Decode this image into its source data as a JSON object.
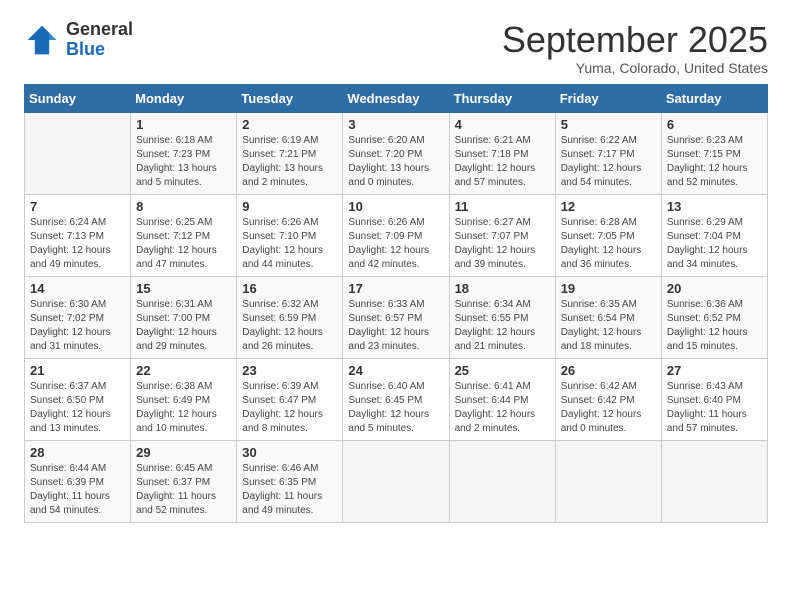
{
  "header": {
    "logo_line1": "General",
    "logo_line2": "Blue",
    "month_title": "September 2025",
    "location": "Yuma, Colorado, United States"
  },
  "calendar": {
    "days_of_week": [
      "Sunday",
      "Monday",
      "Tuesday",
      "Wednesday",
      "Thursday",
      "Friday",
      "Saturday"
    ],
    "weeks": [
      [
        {
          "day": "",
          "sunrise": "",
          "sunset": "",
          "daylight": ""
        },
        {
          "day": "1",
          "sunrise": "Sunrise: 6:18 AM",
          "sunset": "Sunset: 7:23 PM",
          "daylight": "Daylight: 13 hours and 5 minutes."
        },
        {
          "day": "2",
          "sunrise": "Sunrise: 6:19 AM",
          "sunset": "Sunset: 7:21 PM",
          "daylight": "Daylight: 13 hours and 2 minutes."
        },
        {
          "day": "3",
          "sunrise": "Sunrise: 6:20 AM",
          "sunset": "Sunset: 7:20 PM",
          "daylight": "Daylight: 13 hours and 0 minutes."
        },
        {
          "day": "4",
          "sunrise": "Sunrise: 6:21 AM",
          "sunset": "Sunset: 7:18 PM",
          "daylight": "Daylight: 12 hours and 57 minutes."
        },
        {
          "day": "5",
          "sunrise": "Sunrise: 6:22 AM",
          "sunset": "Sunset: 7:17 PM",
          "daylight": "Daylight: 12 hours and 54 minutes."
        },
        {
          "day": "6",
          "sunrise": "Sunrise: 6:23 AM",
          "sunset": "Sunset: 7:15 PM",
          "daylight": "Daylight: 12 hours and 52 minutes."
        }
      ],
      [
        {
          "day": "7",
          "sunrise": "Sunrise: 6:24 AM",
          "sunset": "Sunset: 7:13 PM",
          "daylight": "Daylight: 12 hours and 49 minutes."
        },
        {
          "day": "8",
          "sunrise": "Sunrise: 6:25 AM",
          "sunset": "Sunset: 7:12 PM",
          "daylight": "Daylight: 12 hours and 47 minutes."
        },
        {
          "day": "9",
          "sunrise": "Sunrise: 6:26 AM",
          "sunset": "Sunset: 7:10 PM",
          "daylight": "Daylight: 12 hours and 44 minutes."
        },
        {
          "day": "10",
          "sunrise": "Sunrise: 6:26 AM",
          "sunset": "Sunset: 7:09 PM",
          "daylight": "Daylight: 12 hours and 42 minutes."
        },
        {
          "day": "11",
          "sunrise": "Sunrise: 6:27 AM",
          "sunset": "Sunset: 7:07 PM",
          "daylight": "Daylight: 12 hours and 39 minutes."
        },
        {
          "day": "12",
          "sunrise": "Sunrise: 6:28 AM",
          "sunset": "Sunset: 7:05 PM",
          "daylight": "Daylight: 12 hours and 36 minutes."
        },
        {
          "day": "13",
          "sunrise": "Sunrise: 6:29 AM",
          "sunset": "Sunset: 7:04 PM",
          "daylight": "Daylight: 12 hours and 34 minutes."
        }
      ],
      [
        {
          "day": "14",
          "sunrise": "Sunrise: 6:30 AM",
          "sunset": "Sunset: 7:02 PM",
          "daylight": "Daylight: 12 hours and 31 minutes."
        },
        {
          "day": "15",
          "sunrise": "Sunrise: 6:31 AM",
          "sunset": "Sunset: 7:00 PM",
          "daylight": "Daylight: 12 hours and 29 minutes."
        },
        {
          "day": "16",
          "sunrise": "Sunrise: 6:32 AM",
          "sunset": "Sunset: 6:59 PM",
          "daylight": "Daylight: 12 hours and 26 minutes."
        },
        {
          "day": "17",
          "sunrise": "Sunrise: 6:33 AM",
          "sunset": "Sunset: 6:57 PM",
          "daylight": "Daylight: 12 hours and 23 minutes."
        },
        {
          "day": "18",
          "sunrise": "Sunrise: 6:34 AM",
          "sunset": "Sunset: 6:55 PM",
          "daylight": "Daylight: 12 hours and 21 minutes."
        },
        {
          "day": "19",
          "sunrise": "Sunrise: 6:35 AM",
          "sunset": "Sunset: 6:54 PM",
          "daylight": "Daylight: 12 hours and 18 minutes."
        },
        {
          "day": "20",
          "sunrise": "Sunrise: 6:36 AM",
          "sunset": "Sunset: 6:52 PM",
          "daylight": "Daylight: 12 hours and 15 minutes."
        }
      ],
      [
        {
          "day": "21",
          "sunrise": "Sunrise: 6:37 AM",
          "sunset": "Sunset: 6:50 PM",
          "daylight": "Daylight: 12 hours and 13 minutes."
        },
        {
          "day": "22",
          "sunrise": "Sunrise: 6:38 AM",
          "sunset": "Sunset: 6:49 PM",
          "daylight": "Daylight: 12 hours and 10 minutes."
        },
        {
          "day": "23",
          "sunrise": "Sunrise: 6:39 AM",
          "sunset": "Sunset: 6:47 PM",
          "daylight": "Daylight: 12 hours and 8 minutes."
        },
        {
          "day": "24",
          "sunrise": "Sunrise: 6:40 AM",
          "sunset": "Sunset: 6:45 PM",
          "daylight": "Daylight: 12 hours and 5 minutes."
        },
        {
          "day": "25",
          "sunrise": "Sunrise: 6:41 AM",
          "sunset": "Sunset: 6:44 PM",
          "daylight": "Daylight: 12 hours and 2 minutes."
        },
        {
          "day": "26",
          "sunrise": "Sunrise: 6:42 AM",
          "sunset": "Sunset: 6:42 PM",
          "daylight": "Daylight: 12 hours and 0 minutes."
        },
        {
          "day": "27",
          "sunrise": "Sunrise: 6:43 AM",
          "sunset": "Sunset: 6:40 PM",
          "daylight": "Daylight: 11 hours and 57 minutes."
        }
      ],
      [
        {
          "day": "28",
          "sunrise": "Sunrise: 6:44 AM",
          "sunset": "Sunset: 6:39 PM",
          "daylight": "Daylight: 11 hours and 54 minutes."
        },
        {
          "day": "29",
          "sunrise": "Sunrise: 6:45 AM",
          "sunset": "Sunset: 6:37 PM",
          "daylight": "Daylight: 11 hours and 52 minutes."
        },
        {
          "day": "30",
          "sunrise": "Sunrise: 6:46 AM",
          "sunset": "Sunset: 6:35 PM",
          "daylight": "Daylight: 11 hours and 49 minutes."
        },
        {
          "day": "",
          "sunrise": "",
          "sunset": "",
          "daylight": ""
        },
        {
          "day": "",
          "sunrise": "",
          "sunset": "",
          "daylight": ""
        },
        {
          "day": "",
          "sunrise": "",
          "sunset": "",
          "daylight": ""
        },
        {
          "day": "",
          "sunrise": "",
          "sunset": "",
          "daylight": ""
        }
      ]
    ]
  }
}
